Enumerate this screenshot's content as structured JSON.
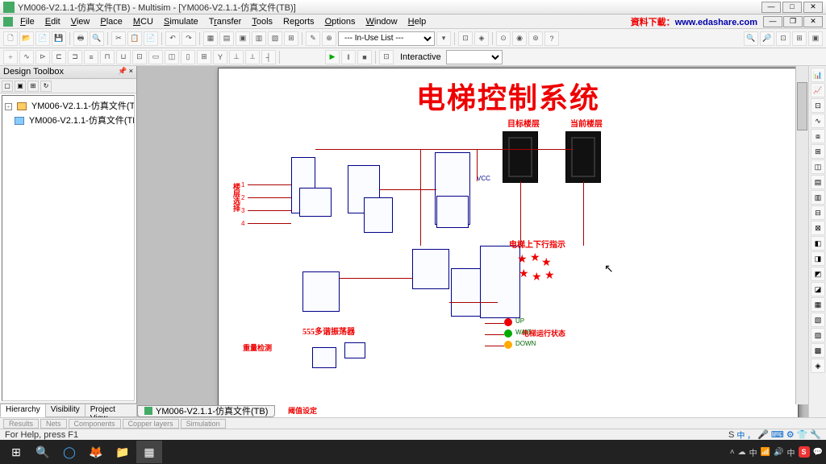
{
  "window": {
    "title": "YM006-V2.1.1-仿真文件(TB) - Multisim - [YM006-V2.1.1-仿真文件(TB)]"
  },
  "menu": {
    "items": [
      "File",
      "Edit",
      "View",
      "Place",
      "MCU",
      "Simulate",
      "Transfer",
      "Tools",
      "Reports",
      "Options",
      "Window",
      "Help"
    ],
    "watermark_label": "資料下載：",
    "watermark_url": "www.edashare.com"
  },
  "toolbar1": {
    "inuse_label": "--- In-Use List ---"
  },
  "toolbar2": {
    "mode_label": "Interactive"
  },
  "toolbox": {
    "title": "Design Toolbox",
    "tree": {
      "root": "YM006-V2.1.1-仿真文件(TB)",
      "child": "YM006-V2.1.1-仿真文件(TB)"
    },
    "tabs": [
      "Hierarchy",
      "Visibility",
      "Project View"
    ]
  },
  "document_tab": "YM006-V2.1.1-仿真文件(TB)",
  "schematic": {
    "title": "电梯控制系统",
    "labels": {
      "target_floor": "目标楼层",
      "current_floor": "当前楼层",
      "floor_input": "楼层选择",
      "updown_indicator": "电梯上下行指示",
      "timer_555": "555多谐振荡器",
      "run_status": "电梯运行状态",
      "weight_detect": "重量检测",
      "threshold": "阈值设定",
      "up": "UP",
      "wait": "WAIT",
      "down": "DOWN",
      "vcc": "VCC"
    },
    "floor_buttons": [
      "1",
      "2",
      "3",
      "4"
    ]
  },
  "bottom_tabs": [
    "Results",
    "Nets",
    "Components",
    "Copper layers",
    "Simulation"
  ],
  "status": {
    "text": "For Help, press F1"
  },
  "taskbar": {
    "tray_text": "中 ，",
    "ime": "S"
  }
}
